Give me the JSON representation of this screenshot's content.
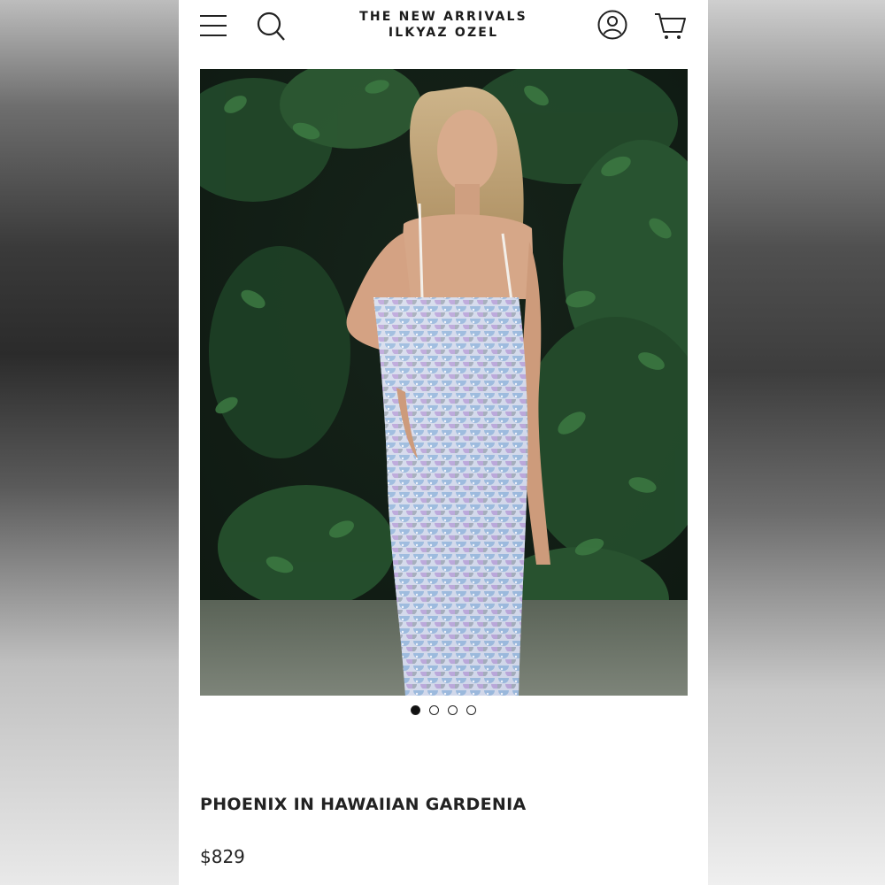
{
  "header": {
    "brand_line1": "THE NEW ARRIVALS",
    "brand_line2": "ILKYAZ OZEL",
    "icons": [
      "menu-icon",
      "search-icon",
      "account-icon",
      "cart-icon"
    ]
  },
  "gallery": {
    "image_count": 4,
    "active_index": 0
  },
  "product": {
    "title": "PHOENIX IN HAWAIIAN GARDENIA",
    "price": "$829"
  },
  "colors": {
    "text": "#222222",
    "background": "#ffffff",
    "foliage": "#1f3b22"
  }
}
